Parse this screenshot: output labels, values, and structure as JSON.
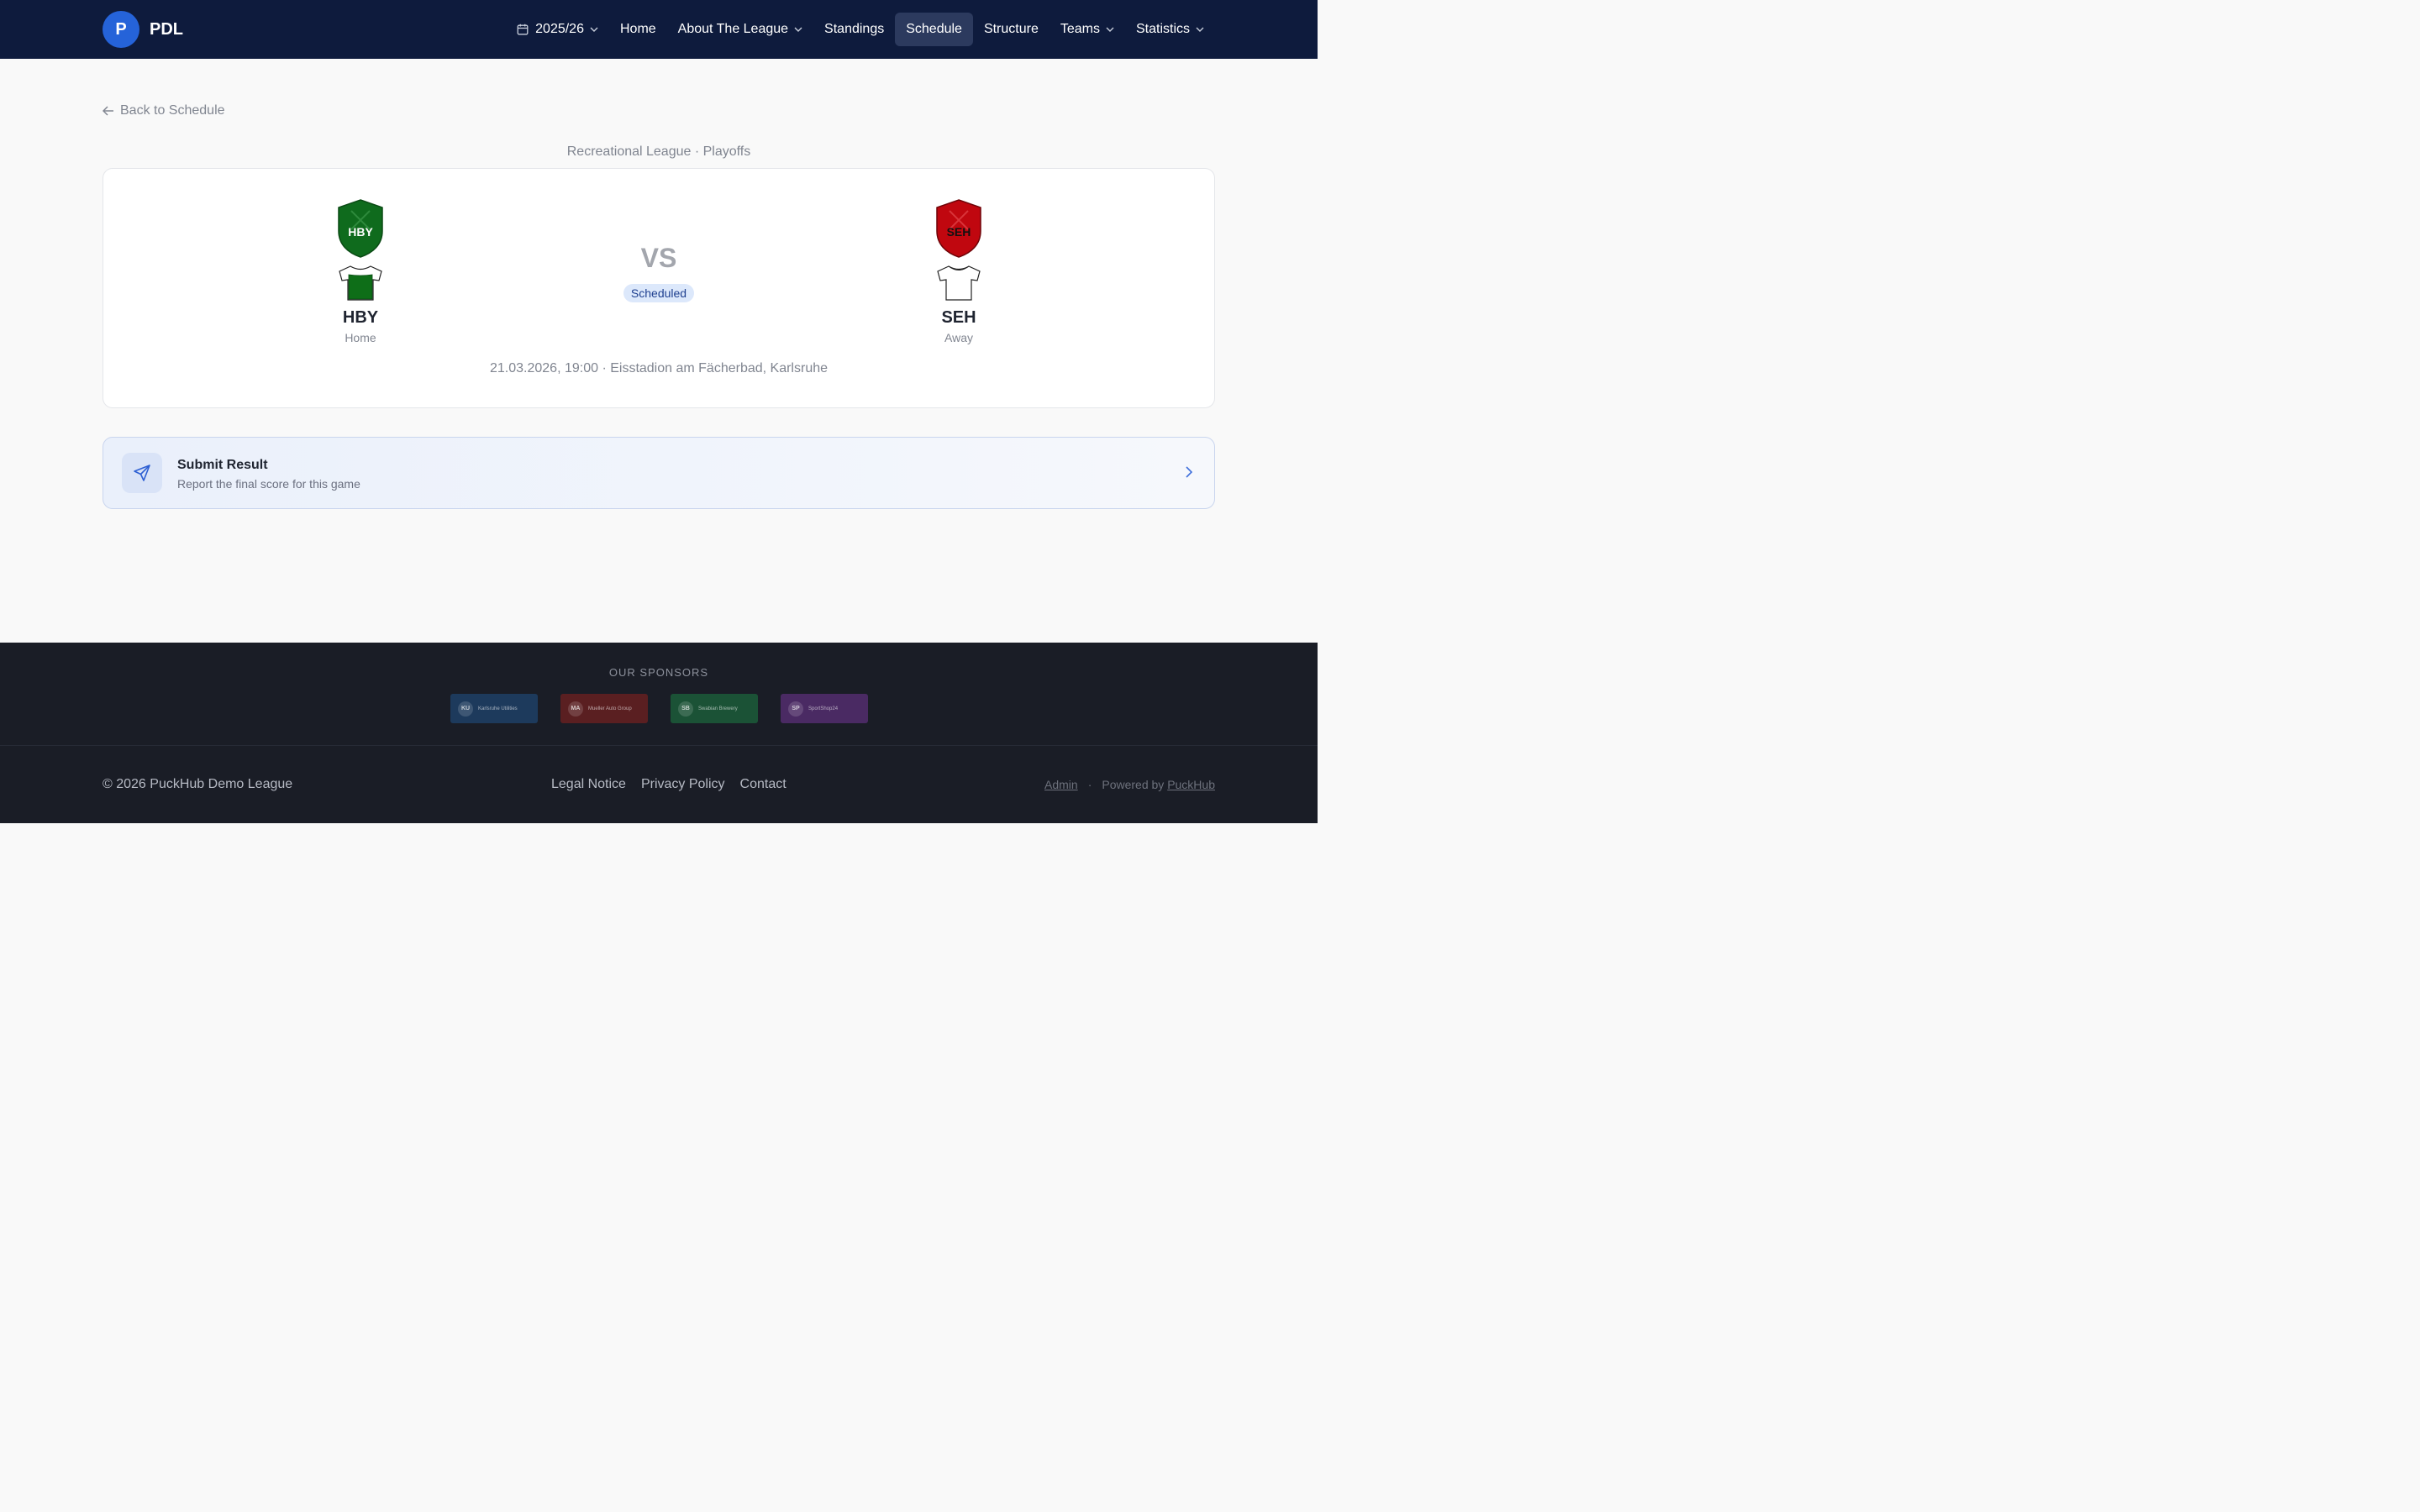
{
  "brand": {
    "initial": "P",
    "name": "PDL"
  },
  "nav": {
    "season": "2025/26",
    "items": [
      {
        "label": "Home"
      },
      {
        "label": "About The League",
        "dropdown": true
      },
      {
        "label": "Standings"
      },
      {
        "label": "Schedule",
        "active": true
      },
      {
        "label": "Structure"
      },
      {
        "label": "Teams",
        "dropdown": true
      },
      {
        "label": "Statistics",
        "dropdown": true
      }
    ]
  },
  "back_link": "Back to Schedule",
  "match": {
    "subtitle": "Recreational League · Playoffs",
    "home": {
      "code": "HBY",
      "role": "Home",
      "shield_color": "#0f6b1d",
      "jersey_color": "#0e6e18"
    },
    "away": {
      "code": "SEH",
      "role": "Away",
      "shield_color": "#c0070f",
      "jersey_color": "#ffffff"
    },
    "vs": "VS",
    "status": "Scheduled",
    "meta": "21.03.2026, 19:00 · Eisstadion am Fächerbad, Karlsruhe"
  },
  "submit": {
    "title": "Submit Result",
    "description": "Report the final score for this game"
  },
  "footer": {
    "sponsors_title": "OUR SPONSORS",
    "sponsors": [
      {
        "initials": "KU",
        "name": "Karlsruhe Utilities",
        "color": "#1d3a5c"
      },
      {
        "initials": "MA",
        "name": "Mueller Auto Group",
        "color": "#5a1f21"
      },
      {
        "initials": "SB",
        "name": "Swabian Brewery",
        "color": "#1b5236"
      },
      {
        "initials": "SP",
        "name": "SportShop24",
        "color": "#4a2a63"
      }
    ],
    "copyright": "© 2026 PuckHub Demo League",
    "links": [
      "Legal Notice",
      "Privacy Policy",
      "Contact"
    ],
    "admin": "Admin",
    "separator": "·",
    "powered_prefix": "Powered by",
    "powered_brand": "PuckHub"
  }
}
